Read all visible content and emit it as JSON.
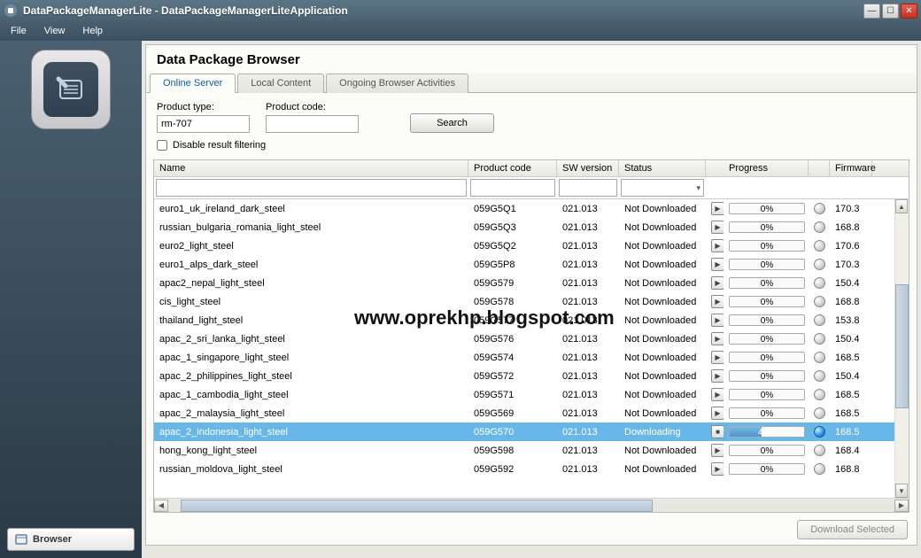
{
  "window": {
    "title": "DataPackageManagerLite - DataPackageManagerLiteApplication"
  },
  "menu": {
    "file": "File",
    "view": "View",
    "help": "Help"
  },
  "sidebar": {
    "browser_btn": "Browser"
  },
  "panel": {
    "title": "Data Package Browser",
    "tabs": [
      "Online Server",
      "Local Content",
      "Ongoing Browser Activities"
    ],
    "active_tab": 0
  },
  "search": {
    "product_type_label": "Product type:",
    "product_type_value": "rm-707",
    "product_code_label": "Product code:",
    "product_code_value": "",
    "search_btn": "Search",
    "disable_filter_label": "Disable result filtering",
    "disable_filter_checked": false
  },
  "grid": {
    "headers": {
      "name": "Name",
      "code": "Product code",
      "sw": "SW version",
      "status": "Status",
      "progress": "Progress",
      "firmware": "Firmware"
    },
    "rows": [
      {
        "name": "euro1_uk_ireland_dark_steel",
        "code": "059G5Q1",
        "sw": "021.013",
        "status": "Not Downloaded",
        "play": "▶",
        "progress": 0,
        "progress_text": "0%",
        "firmware": "170.3"
      },
      {
        "name": "russian_bulgaria_romania_light_steel",
        "code": "059G5Q3",
        "sw": "021.013",
        "status": "Not Downloaded",
        "play": "▶",
        "progress": 0,
        "progress_text": "0%",
        "firmware": "168.8"
      },
      {
        "name": "euro2_light_steel",
        "code": "059G5Q2",
        "sw": "021.013",
        "status": "Not Downloaded",
        "play": "▶",
        "progress": 0,
        "progress_text": "0%",
        "firmware": "170.6"
      },
      {
        "name": "euro1_alps_dark_steel",
        "code": "059G5P8",
        "sw": "021.013",
        "status": "Not Downloaded",
        "play": "▶",
        "progress": 0,
        "progress_text": "0%",
        "firmware": "170.3"
      },
      {
        "name": "apac2_nepal_light_steel",
        "code": "059G579",
        "sw": "021.013",
        "status": "Not Downloaded",
        "play": "▶",
        "progress": 0,
        "progress_text": "0%",
        "firmware": "150.4"
      },
      {
        "name": "cis_light_steel",
        "code": "059G578",
        "sw": "021.013",
        "status": "Not Downloaded",
        "play": "▶",
        "progress": 0,
        "progress_text": "0%",
        "firmware": "168.8"
      },
      {
        "name": "thailand_light_steel",
        "code": "059G577",
        "sw": "021.013",
        "status": "Not Downloaded",
        "play": "▶",
        "progress": 0,
        "progress_text": "0%",
        "firmware": "153.8"
      },
      {
        "name": "apac_2_sri_lanka_light_steel",
        "code": "059G576",
        "sw": "021.013",
        "status": "Not Downloaded",
        "play": "▶",
        "progress": 0,
        "progress_text": "0%",
        "firmware": "150.4"
      },
      {
        "name": "apac_1_singapore_light_steel",
        "code": "059G574",
        "sw": "021.013",
        "status": "Not Downloaded",
        "play": "▶",
        "progress": 0,
        "progress_text": "0%",
        "firmware": "168.5"
      },
      {
        "name": "apac_2_philippines_light_steel",
        "code": "059G572",
        "sw": "021.013",
        "status": "Not Downloaded",
        "play": "▶",
        "progress": 0,
        "progress_text": "0%",
        "firmware": "150.4"
      },
      {
        "name": "apac_1_cambodia_light_steel",
        "code": "059G571",
        "sw": "021.013",
        "status": "Not Downloaded",
        "play": "▶",
        "progress": 0,
        "progress_text": "0%",
        "firmware": "168.5"
      },
      {
        "name": "apac_2_malaysia_light_steel",
        "code": "059G569",
        "sw": "021.013",
        "status": "Not Downloaded",
        "play": "▶",
        "progress": 0,
        "progress_text": "0%",
        "firmware": "168.5"
      },
      {
        "name": "apac_2_indonesia_light_steel",
        "code": "059G570",
        "sw": "021.013",
        "status": "Downloading",
        "play": "■",
        "progress": 43,
        "progress_text": "43%",
        "firmware": "168.5",
        "selected": true
      },
      {
        "name": "hong_kong_light_steel",
        "code": "059G598",
        "sw": "021.013",
        "status": "Not Downloaded",
        "play": "▶",
        "progress": 0,
        "progress_text": "0%",
        "firmware": "168.4"
      },
      {
        "name": "russian_moldova_light_steel",
        "code": "059G592",
        "sw": "021.013",
        "status": "Not Downloaded",
        "play": "▶",
        "progress": 0,
        "progress_text": "0%",
        "firmware": "168.8"
      }
    ]
  },
  "footer": {
    "download_btn": "Download Selected"
  },
  "watermark": "www.oprekhp.blogspot.com"
}
